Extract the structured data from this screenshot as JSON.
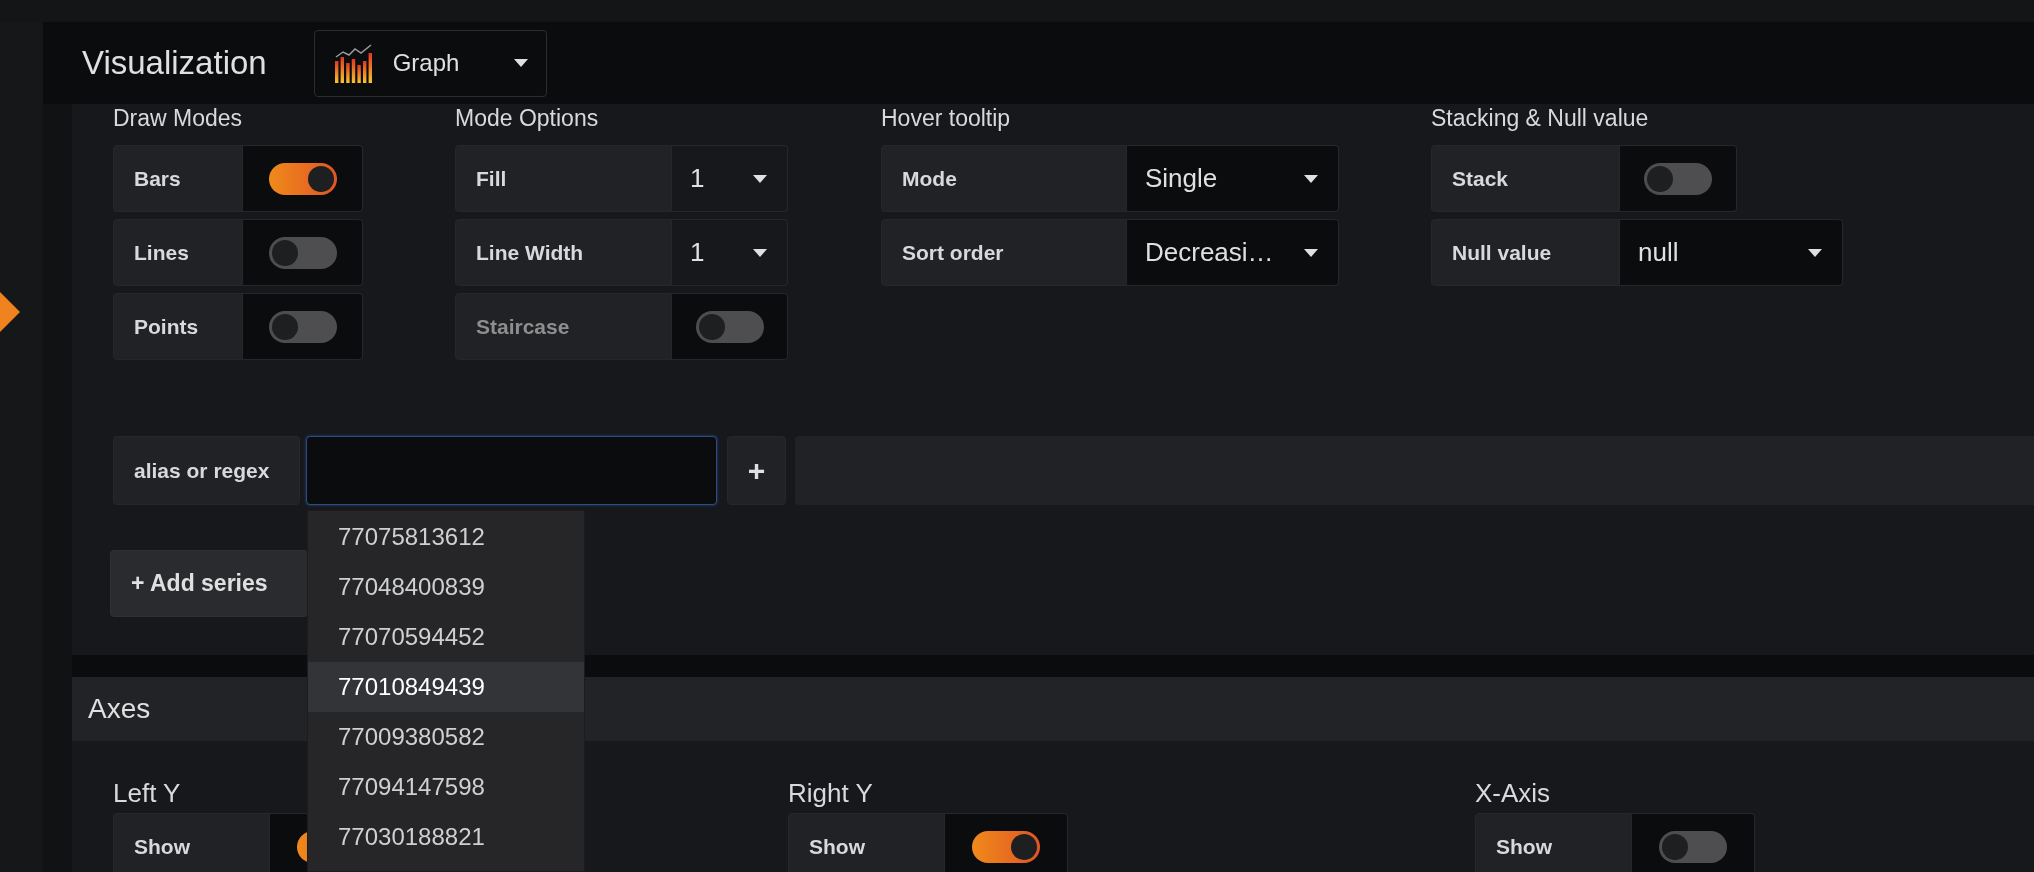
{
  "header": {
    "title": "Visualization",
    "picker": {
      "label": "Graph"
    }
  },
  "groups": [
    {
      "heading": "Draw Modes",
      "rows": [
        {
          "kind": "switch",
          "label": "Bars",
          "on": true,
          "disabled": false
        },
        {
          "kind": "switch",
          "label": "Lines",
          "on": false,
          "disabled": false
        },
        {
          "kind": "switch",
          "label": "Points",
          "on": false,
          "disabled": false
        }
      ]
    },
    {
      "heading": "Mode Options",
      "rows": [
        {
          "kind": "select",
          "label": "Fill",
          "value": "1"
        },
        {
          "kind": "select",
          "label": "Line Width",
          "value": "1"
        },
        {
          "kind": "switch",
          "label": "Staircase",
          "on": false,
          "disabled": true
        }
      ]
    },
    {
      "heading": "Hover tooltip",
      "rows": [
        {
          "kind": "select",
          "label": "Mode",
          "value": "Single"
        },
        {
          "kind": "select",
          "label": "Sort order",
          "value": "Decreasi…"
        }
      ]
    },
    {
      "heading": "Stacking & Null value",
      "rows": [
        {
          "kind": "switch",
          "label": "Stack",
          "on": false,
          "disabled": false
        },
        {
          "kind": "select",
          "label": "Null value",
          "value": "null"
        }
      ]
    }
  ],
  "override": {
    "label": "alias or regex",
    "add_symbol": "+",
    "add_button": "+ Add series"
  },
  "suggestions": [
    {
      "label": "77075813612",
      "selected": false
    },
    {
      "label": "77048400839",
      "selected": false
    },
    {
      "label": "77070594452",
      "selected": false
    },
    {
      "label": "77010849439",
      "selected": true
    },
    {
      "label": "77009380582",
      "selected": false
    },
    {
      "label": "77094147598",
      "selected": false
    },
    {
      "label": "77030188821",
      "selected": false
    }
  ],
  "axes": {
    "title": "Axes",
    "columns": [
      {
        "heading": "Left Y",
        "rows": [
          {
            "kind": "switch",
            "label": "Show",
            "on": true,
            "disabled": false
          }
        ]
      },
      {
        "heading": "Right Y",
        "rows": [
          {
            "kind": "switch",
            "label": "Show",
            "on": true,
            "disabled": false
          }
        ]
      },
      {
        "heading": "X-Axis",
        "rows": [
          {
            "kind": "switch",
            "label": "Show",
            "on": false,
            "disabled": false
          }
        ]
      }
    ]
  }
}
